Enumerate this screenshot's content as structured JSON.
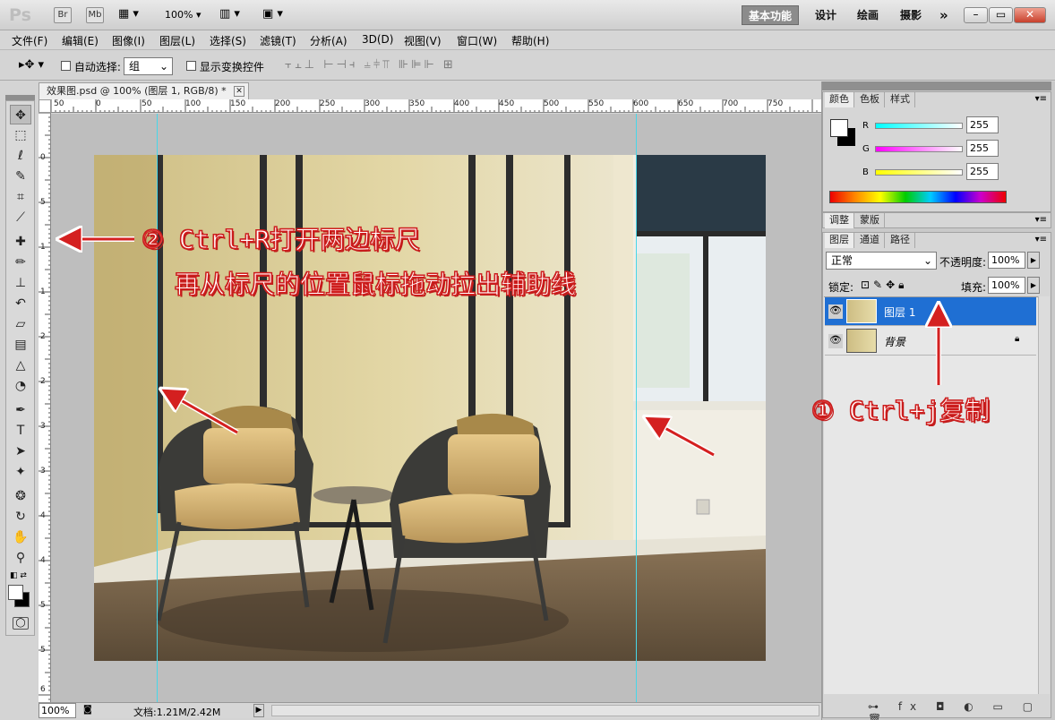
{
  "title_bar": {
    "logo": "Ps",
    "bridge_btn": "Br",
    "minibridge_btn": "Mb",
    "zoom": "100%",
    "workspaces": [
      "基本功能",
      "设计",
      "绘画",
      "摄影"
    ],
    "more": "»"
  },
  "menu": [
    "文件(F)",
    "编辑(E)",
    "图像(I)",
    "图层(L)",
    "选择(S)",
    "滤镜(T)",
    "分析(A)",
    "3D(D)",
    "视图(V)",
    "窗口(W)",
    "帮助(H)"
  ],
  "options": {
    "auto_select_label": "自动选择:",
    "auto_select_value": "组",
    "show_transform_label": "显示变换控件"
  },
  "document": {
    "tab_title": "效果图.psd @ 100% (图层 1, RGB/8) *",
    "ruler_h": [
      "50",
      "0",
      "50",
      "100",
      "150",
      "200",
      "250",
      "300",
      "350",
      "400",
      "450",
      "500",
      "550",
      "600",
      "650",
      "700",
      "750"
    ],
    "ruler_v": [
      "0",
      "5",
      "1",
      "1",
      "2",
      "2",
      "3",
      "3",
      "4",
      "4",
      "5",
      "5",
      "6"
    ],
    "zoom": "100%",
    "doc_info": "文档:1.21M/2.42M"
  },
  "color_panel": {
    "tabs": [
      "颜色",
      "色板",
      "样式"
    ],
    "r_label": "R",
    "r_value": "255",
    "g_label": "G",
    "g_value": "255",
    "b_label": "B",
    "b_value": "255"
  },
  "adjust_panel": {
    "tabs": [
      "调整",
      "蒙版"
    ]
  },
  "layers_panel": {
    "tabs": [
      "图层",
      "通道",
      "路径"
    ],
    "blend_mode": "正常",
    "opacity_label": "不透明度:",
    "opacity_value": "100%",
    "lock_label": "锁定:",
    "fill_label": "填充:",
    "fill_value": "100%",
    "layers": [
      {
        "name": "图层 1",
        "selected": true
      },
      {
        "name": "背景",
        "selected": false,
        "locked": true
      }
    ]
  },
  "annotations": {
    "step1": "① Ctrl+j复制",
    "step2_line1": "② Ctrl+R打开两边标尺",
    "step2_line2": "再从标尺的位置鼠标拖动拉出辅助线"
  },
  "colors": {
    "accent_blue": "#1f6fd3",
    "guide": "#48d6e8",
    "annotation_red": "#d42020"
  }
}
